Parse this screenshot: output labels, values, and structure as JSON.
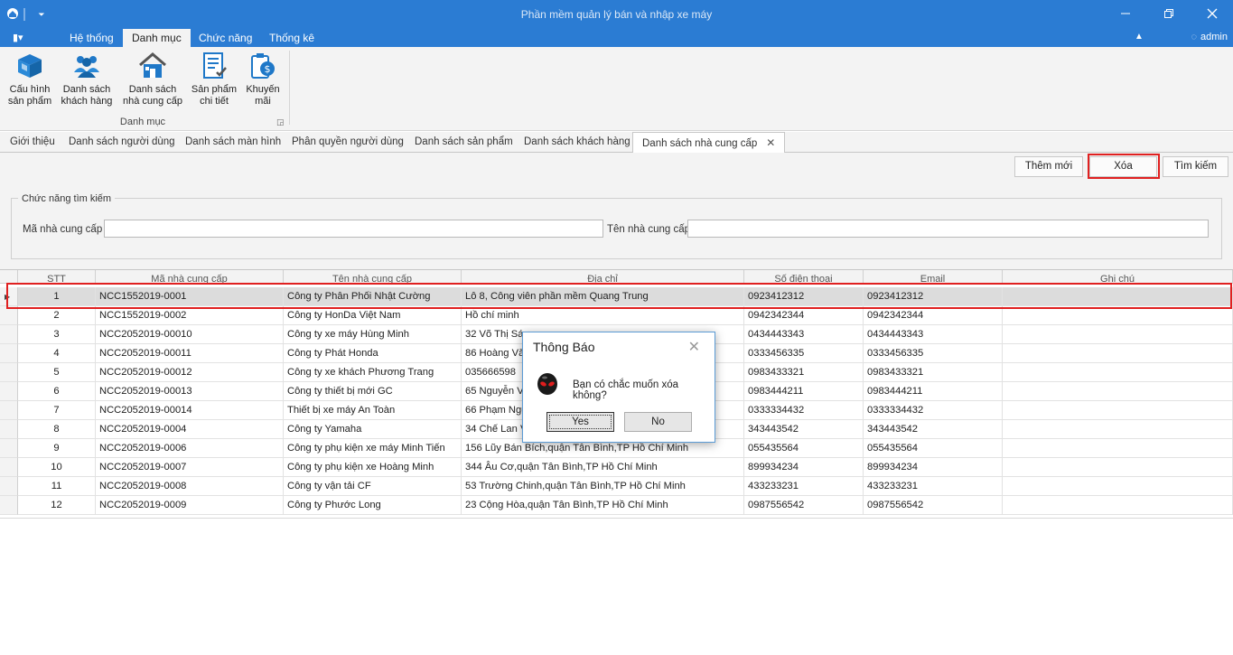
{
  "window": {
    "title": "Phần mềm quản lý bán và nhập xe máy",
    "app_icon": "app-icon",
    "qat_label": "⏷"
  },
  "ribbon": {
    "file_menu_label": "▮▾",
    "tabs": [
      "Hệ thống",
      "Danh mục",
      "Chức năng",
      "Thống kê"
    ],
    "active_tab": "Danh mục",
    "user": "admin",
    "group_label": "Danh mục",
    "buttons": [
      {
        "line1": "Cấu hình",
        "line2": "sản phẩm",
        "icon": "box-icon"
      },
      {
        "line1": "Danh sách",
        "line2": "khách hàng",
        "icon": "users-icon"
      },
      {
        "line1": "Danh sách",
        "line2": "nhà cung cấp",
        "icon": "house-icon"
      },
      {
        "line1": "Sản phẩm",
        "line2": "chi tiết",
        "icon": "checklist-icon"
      },
      {
        "line1": "Khuyến",
        "line2": "mãi",
        "icon": "promotion-icon"
      }
    ]
  },
  "doc_tabs": [
    "Giới thiệu",
    "Danh sách người dùng",
    "Danh sách màn hình",
    "Phân quyền người dùng",
    "Danh sách sản phẩm",
    "Danh sách khách hàng",
    "Danh sách nhà cung cấp"
  ],
  "toolbar": {
    "add_label": "Thêm mới",
    "delete_label": "Xóa",
    "search_label": "Tìm kiếm"
  },
  "search": {
    "legend": "Chức năng tìm kiếm",
    "code_label": "Mã nhà cung cấp",
    "code_value": "",
    "name_label": "Tên nhà cung cấp",
    "name_value": ""
  },
  "table": {
    "columns": [
      "STT",
      "Mã nhà cung cấp",
      "Tên nhà cung cấp",
      "Địa chỉ",
      "Số điện thoại",
      "Email",
      "Ghi chú"
    ],
    "rows": [
      [
        "1",
        "NCC1552019-0001",
        "Công ty Phân Phối Nhật Cường",
        "Lô 8, Công viên phần mềm Quang Trung",
        "0923412312",
        "0923412312",
        ""
      ],
      [
        "2",
        "NCC1552019-0002",
        "Công ty HonDa Việt Nam",
        "Hồ chí minh",
        "0942342344",
        "0942342344",
        ""
      ],
      [
        "3",
        "NCC2052019-00010",
        "Công ty xe máy Hùng Minh",
        "32 Võ Thị Sáu",
        "0434443343",
        "0434443343",
        ""
      ],
      [
        "4",
        "NCC2052019-00011",
        "Công ty Phát Honda",
        "86 Hoàng Văn",
        "0333456335",
        "0333456335",
        ""
      ],
      [
        "5",
        "NCC2052019-00012",
        "Công ty xe khách Phương Trang",
        "035666598",
        "0983433321",
        "0983433321",
        ""
      ],
      [
        "6",
        "NCC2052019-00013",
        "Công ty thiết bị mới GC",
        "65 Nguyễn Vă",
        "0983444211",
        "0983444211",
        ""
      ],
      [
        "7",
        "NCC2052019-00014",
        "Thiết bị xe máy An Toàn",
        "66 Phạm Ngũ",
        "0333334432",
        "0333334432",
        ""
      ],
      [
        "8",
        "NCC2052019-0004",
        "Công ty Yamaha",
        "34 Chế Lan V",
        "343443542",
        "343443542",
        ""
      ],
      [
        "9",
        "NCC2052019-0006",
        "Công ty phụ kiện xe máy Minh Tiến",
        "156 Lũy Bán Bích,quận Tân Bình,TP Hồ Chí Minh",
        "055435564",
        "055435564",
        ""
      ],
      [
        "10",
        "NCC2052019-0007",
        "Công ty phụ kiện xe Hoàng Minh",
        "344 Âu Cơ,quận Tân Bình,TP Hồ Chí Minh",
        "899934234",
        "899934234",
        ""
      ],
      [
        "11",
        "NCC2052019-0008",
        "Công ty vận tải CF",
        "53 Trường Chinh,quận Tân Bình,TP Hồ Chí Minh",
        "433233231",
        "433233231",
        ""
      ],
      [
        "12",
        "NCC2052019-0009",
        "Công ty Phước Long",
        "23 Cộng Hòa,quận Tân Bình,TP Hồ Chí Minh",
        "0987556542",
        "0987556542",
        ""
      ]
    ],
    "selected_row": 0
  },
  "dialog": {
    "title": "Thông Báo",
    "message": "Bạn có chắc muốn xóa không?",
    "yes_label": "Yes",
    "no_label": "No",
    "icon": "alien-warning-icon"
  },
  "colors": {
    "accent": "#2b7cd3",
    "highlight": "#e02020"
  }
}
